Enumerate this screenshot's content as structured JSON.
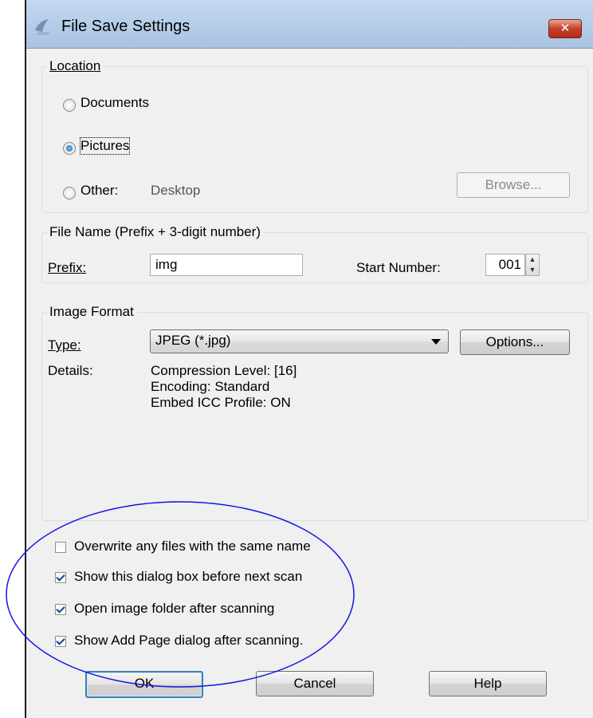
{
  "window": {
    "title": "File Save Settings",
    "close_label": "✕"
  },
  "location": {
    "legend": "Location",
    "options": [
      {
        "label": "Documents",
        "checked": false
      },
      {
        "label": "Pictures",
        "checked": true
      },
      {
        "label": "Other:",
        "checked": false
      }
    ],
    "other_value": "Desktop",
    "browse_label": "Browse..."
  },
  "file_name": {
    "legend": "File Name (Prefix + 3-digit number)",
    "prefix_label": "Prefix:",
    "prefix_value": "img",
    "start_number_label": "Start Number:",
    "start_number_value": "001"
  },
  "image_format": {
    "legend": "Image Format",
    "type_label": "Type:",
    "type_value": "JPEG (*.jpg)",
    "options_label": "Options...",
    "details_label": "Details:",
    "details_lines": [
      "Compression Level: [16]",
      "Encoding: Standard",
      "Embed ICC Profile: ON"
    ]
  },
  "checkboxes": [
    {
      "label": "Overwrite any files with the same name",
      "checked": false
    },
    {
      "label": "Show this dialog box before next scan",
      "checked": true
    },
    {
      "label": "Open image folder after scanning",
      "checked": true
    },
    {
      "label": "Show Add Page dialog after scanning.",
      "checked": true
    }
  ],
  "buttons": {
    "ok": "OK",
    "cancel": "Cancel",
    "help": "Help"
  },
  "annotation": {
    "ellipse_color": "#1414e6"
  }
}
